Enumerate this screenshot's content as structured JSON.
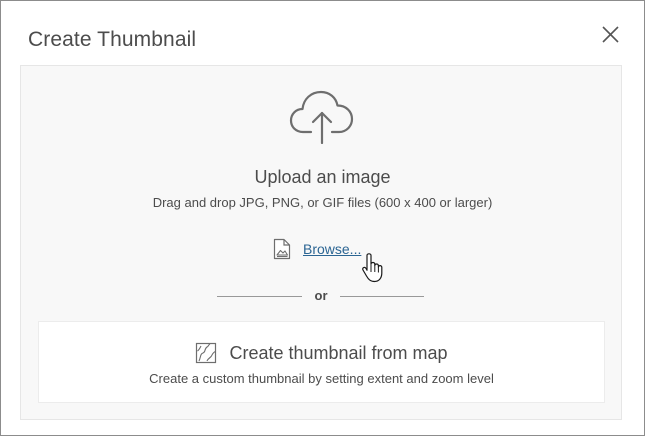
{
  "dialog": {
    "title": "Create Thumbnail",
    "close_icon": "close-x-icon"
  },
  "upload": {
    "icon": "cloud-upload-icon",
    "title": "Upload an image",
    "description": "Drag and drop JPG, PNG, or GIF files (600 x 400 or larger)",
    "browse_icon": "image-file-icon",
    "browse_label": "Browse..."
  },
  "divider": {
    "label": "or"
  },
  "from_map": {
    "icon": "map-thumbnail-icon",
    "title": "Create thumbnail from map",
    "description": "Create a custom thumbnail by setting extent and zoom level"
  },
  "colors": {
    "text": "#4c4c4c",
    "link": "#2b6593",
    "panel_bg": "#f8f8f8",
    "border": "#8c8c8c"
  }
}
